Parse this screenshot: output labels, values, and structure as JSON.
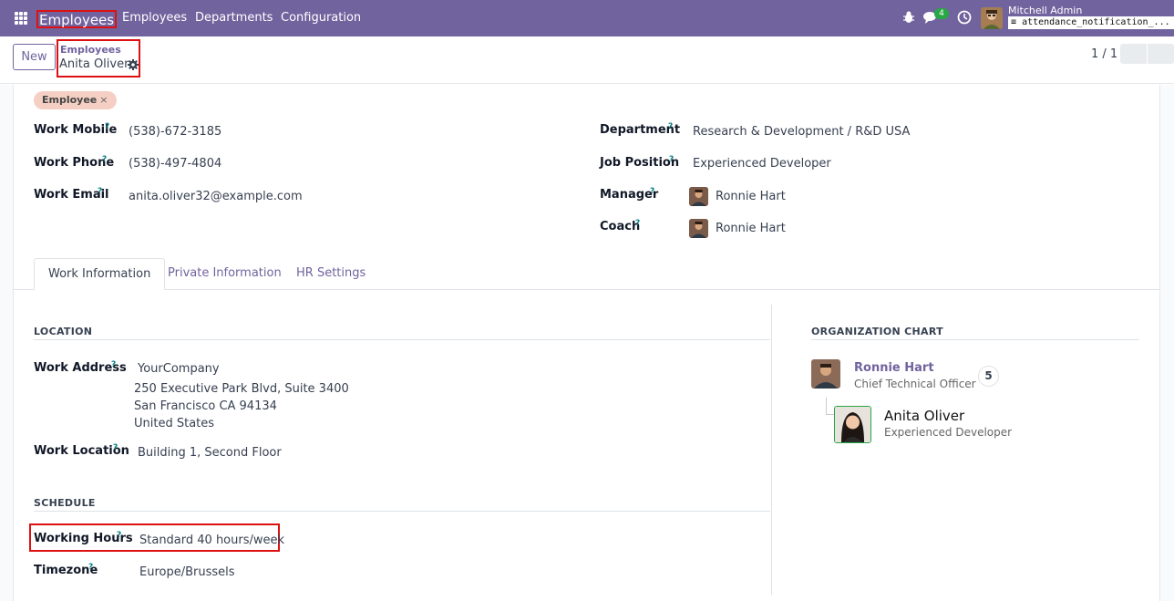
{
  "navbar": {
    "app_name": "Employees",
    "menu": [
      "Employees",
      "Departments",
      "Configuration"
    ],
    "chat_count": "4",
    "user_name": "Mitchell Admin",
    "database": "attendance_notification_..."
  },
  "control": {
    "new_label": "New",
    "breadcrumb_parent": "Employees",
    "breadcrumb_current": "Anita Oliver",
    "pager": "1 / 1"
  },
  "employee": {
    "tag": "Employee",
    "tag_remove": "×",
    "help_mark": "?",
    "left_fields": [
      {
        "label": "Work Mobile",
        "value": "(538)-672-3185"
      },
      {
        "label": "Work Phone",
        "value": "(538)-497-4804"
      },
      {
        "label": "Work Email",
        "value": "anita.oliver32@example.com"
      }
    ],
    "right_fields": [
      {
        "label": "Department",
        "value": "Research & Development / R&D USA"
      },
      {
        "label": "Job Position",
        "value": "Experienced Developer"
      },
      {
        "label": "Manager",
        "value": "Ronnie Hart"
      },
      {
        "label": "Coach",
        "value": "Ronnie Hart"
      }
    ]
  },
  "tabs": [
    {
      "label": "Work Information",
      "active": true
    },
    {
      "label": "Private Information",
      "active": false
    },
    {
      "label": "HR Settings",
      "active": false
    }
  ],
  "work_info": {
    "location_title": "LOCATION",
    "work_address_label": "Work Address",
    "address_lines": [
      "YourCompany",
      "250 Executive Park Blvd, Suite 3400",
      "San Francisco CA 94134",
      "United States"
    ],
    "work_location_label": "Work Location",
    "work_location_value": "Building 1, Second Floor",
    "schedule_title": "SCHEDULE",
    "working_hours_label": "Working Hours",
    "working_hours_value": "Standard 40 hours/week",
    "timezone_label": "Timezone",
    "timezone_value": "Europe/Brussels"
  },
  "org_chart": {
    "title": "ORGANIZATION CHART",
    "manager_name": "Ronnie Hart",
    "manager_job": "Chief Technical Officer",
    "manager_reports": "5",
    "self_name": "Anita Oliver",
    "self_job": "Experienced Developer"
  },
  "colors": {
    "navbar": "#71639e",
    "accent": "#71639e",
    "highlight_box": "#dd1111",
    "tag_bg": "#f5cfc4",
    "help_mark": "#017e84"
  }
}
